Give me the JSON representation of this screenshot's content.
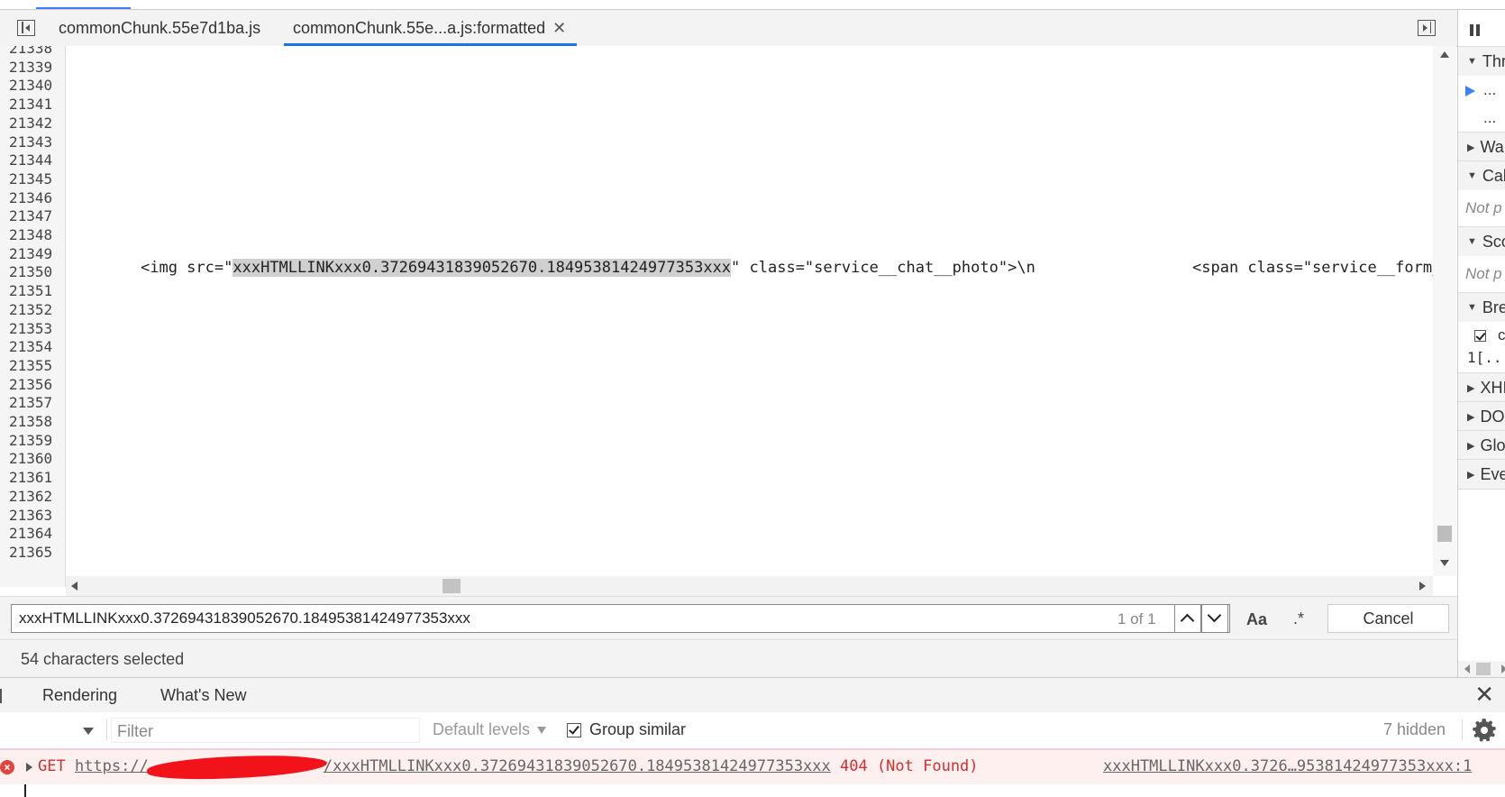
{
  "tabs": {
    "tab1": "commonChunk.55e7d1ba.js",
    "tab2": "commonChunk.55e...a.js:formatted",
    "close_glyph": "✕"
  },
  "editor": {
    "line_numbers": [
      "21338",
      "21339",
      "21340",
      "21341",
      "21342",
      "21343",
      "21344",
      "21345",
      "21346",
      "21347",
      "21348",
      "21349",
      "21350",
      "21351",
      "21352",
      "21353",
      "21354",
      "21355",
      "21356",
      "21357",
      "21358",
      "21359",
      "21360",
      "21361",
      "21362",
      "21363",
      "21364",
      "21365"
    ],
    "code_prefix": "<img src=\"",
    "code_highlight": "xxxHTMLLINKxxx0.37269431839052670.18495381424977353xxx",
    "code_suffix": "\" class=\"service__chat__photo\">\\n",
    "code_continued": "<span class=\"service__form_"
  },
  "search": {
    "query": "xxxHTMLLINKxxx0.37269431839052670.18495381424977353xxx",
    "count": "1 of 1",
    "case_label": "Aa",
    "regex_label": ".*",
    "cancel_label": "Cancel"
  },
  "status": {
    "selection": "54 characters selected"
  },
  "sidebar": {
    "threads": "Thr",
    "thread_item_1": "...",
    "thread_item_2": "...",
    "watch": "Wa",
    "callstack": "Call",
    "callstack_body": "Not p",
    "scope": "Sco",
    "scope_body": "Not p",
    "breakpoints": "Bre",
    "bp_item_line1": "c",
    "bp_item_line2": "1[...",
    "xhr": "XHI",
    "dom": "DO",
    "global": "Glo",
    "event": "Eve"
  },
  "drawer": {
    "tab_rendering": "Rendering",
    "tab_whatsnew": "What's New",
    "close_glyph": "✕"
  },
  "console": {
    "filter_placeholder": "Filter",
    "levels": "Default levels",
    "group_similar": "Group similar",
    "hidden": "7 hidden"
  },
  "error": {
    "method": "GET ",
    "url_start": "https://",
    "url_end": "/xxxHTMLLINKxxx0.37269431839052670.18495381424977353xxx",
    "status": " 404 (Not Found)",
    "source": "xxxHTMLLINKxxx0.3726…95381424977353xxx:1"
  },
  "colors": {
    "accent_tab": "#1a73e8",
    "error_text": "#d32f2f",
    "error_bg": "#fff0f0",
    "redaction": "#f2131a"
  }
}
